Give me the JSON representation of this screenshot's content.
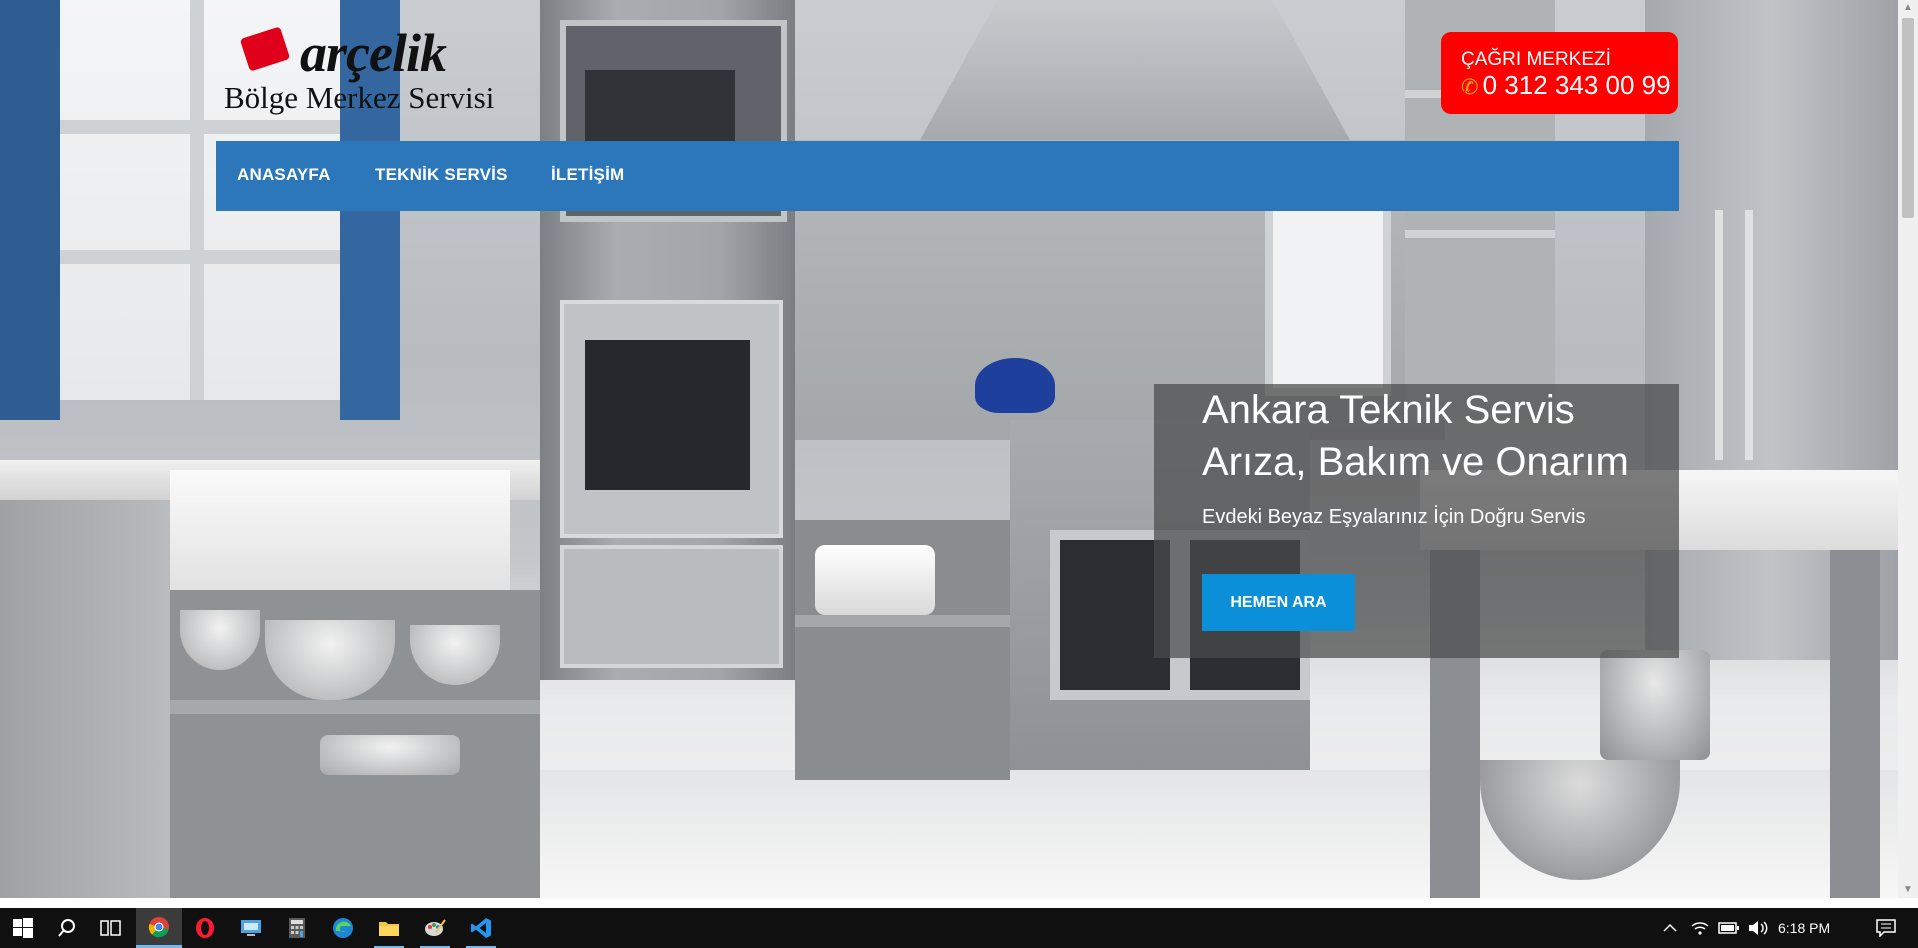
{
  "header": {
    "logo_brand": "arçelik",
    "logo_subtitle": "Bölge Merkez Servisi"
  },
  "call_center": {
    "label": "ÇAĞRI MERKEZİ",
    "phone": "0 312 343 00 99",
    "icon": "phone-icon",
    "background": "#ff0000"
  },
  "nav": {
    "items": [
      {
        "label": "ANASAYFA"
      },
      {
        "label": "TEKNİK SERVİS"
      },
      {
        "label": "İLETİŞİM"
      }
    ],
    "background": "#2c77ba"
  },
  "hero": {
    "title_line1": "Ankara Teknik Servis",
    "title_line2": "Arıza, Bakım ve Onarım",
    "subtitle": "Evdeki Beyaz Eşyalarınız İçin Doğru Servis",
    "cta_label": "HEMEN ARA",
    "cta_color": "#0b8fd9"
  },
  "taskbar": {
    "apps": [
      {
        "name": "start-icon"
      },
      {
        "name": "search-icon"
      },
      {
        "name": "task-view-icon"
      },
      {
        "name": "chrome-icon",
        "state": "active"
      },
      {
        "name": "opera-icon"
      },
      {
        "name": "remote-desktop-icon"
      },
      {
        "name": "calculator-icon"
      },
      {
        "name": "edge-icon"
      },
      {
        "name": "file-explorer-icon",
        "state": "open"
      },
      {
        "name": "paint-icon",
        "state": "open"
      },
      {
        "name": "vscode-icon",
        "state": "open"
      }
    ],
    "tray_icons": [
      "chevron-up-icon",
      "network-icon",
      "battery-icon",
      "volume-icon"
    ],
    "time": "6:18 PM",
    "notification_icon": "notification-icon"
  }
}
